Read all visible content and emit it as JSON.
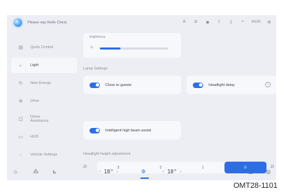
{
  "status_bar": {
    "voice_prompt": "Please say Hello Chery",
    "icons": [
      "letter-a-icon",
      "media-icon",
      "eye-icon",
      "bluetooth-icon",
      "signal-icon",
      "wifi-icon",
      "settings-gear-icon"
    ],
    "time": "04:09",
    "glyphs": {
      "letter-a": "A",
      "media": "◘",
      "eye": "◉",
      "bluetooth": "ᛒ",
      "signal": "⁒",
      "wifi": "≈",
      "gear": "⚙"
    }
  },
  "sidebar": {
    "items": [
      {
        "label": "Quick Control",
        "icon": "quick-control-icon",
        "glyph": "▤",
        "active": false
      },
      {
        "label": "Light",
        "icon": "light-icon",
        "glyph": "☼",
        "active": true
      },
      {
        "label": "New Energy",
        "icon": "new-energy-icon",
        "glyph": "↻",
        "active": false
      },
      {
        "label": "Drive",
        "icon": "drive-icon",
        "glyph": "⊛",
        "active": false
      },
      {
        "label": "Driver\nAssistance",
        "icon": "driver-assistance-icon",
        "glyph": "◫",
        "active": false
      },
      {
        "label": "HUD",
        "icon": "hud-icon",
        "glyph": "▭",
        "active": false
      },
      {
        "label": "Vehicle Settings",
        "icon": "vehicle-settings-icon",
        "glyph": "◌",
        "active": false
      }
    ]
  },
  "main": {
    "brightness": {
      "label": "brightness",
      "value": 0.3,
      "icon_glyph": "☼"
    },
    "lamp_settings_title": "Lamp Settings",
    "toggles": {
      "close_to_guests": {
        "label": "Close to guests",
        "on": true
      },
      "headlight_delay": {
        "label": "Headlight delay",
        "on": true,
        "info_glyph": "i"
      },
      "intelligent_high_beam": {
        "label": "Intelligent high beam assist",
        "on": true
      }
    },
    "headlight_height": {
      "title": "Headlight height adjustment",
      "left_icon_glyph": "ⅅ",
      "right_icon_glyph": "ⅅ",
      "options": [
        "3",
        "2",
        "1",
        "0"
      ],
      "selected": "0"
    }
  },
  "bottom_bar": {
    "home_glyph": "⌂",
    "apps_glyph": "⁂",
    "seat_glyph": "⊾",
    "left_temp": "18",
    "right_temp": "18",
    "temp_unit": "°",
    "arrow_left": "‹",
    "arrow_right": "›",
    "fan_glyph": "✲",
    "wiper_glyph": "⤢",
    "hazard_glyph": "△",
    "voice_glyph": "◎"
  },
  "caption": "OMT28-1101",
  "colors": {
    "accent": "#2d6ee6",
    "screen_bg": "#eceef3",
    "card_bg": "#f7f8fb"
  }
}
